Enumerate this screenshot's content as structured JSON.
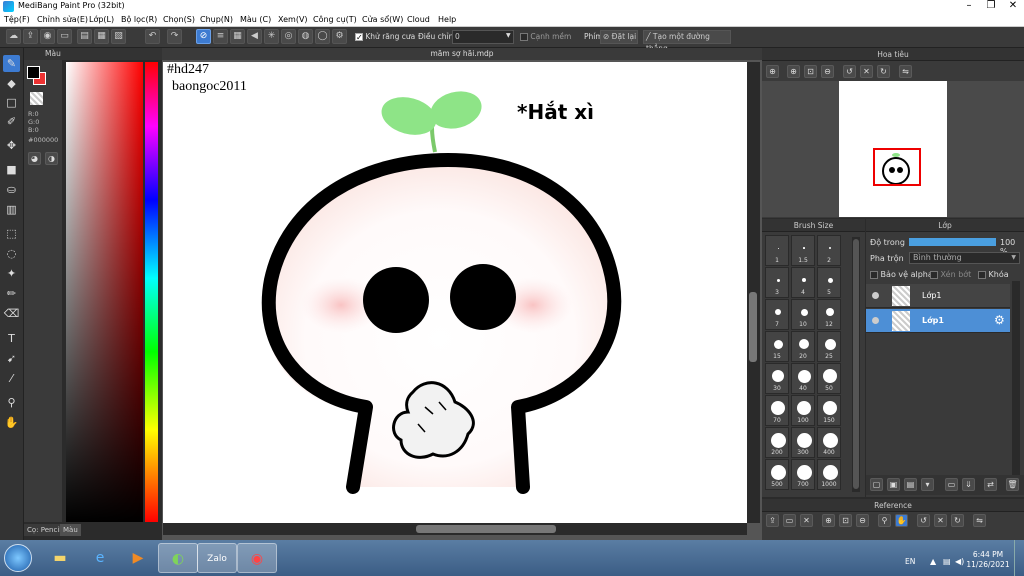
{
  "window": {
    "title": "MediBang Paint Pro (32bit)"
  },
  "menu": [
    "Tệp(F)",
    "Chỉnh sửa(E)",
    "Lớp(L)",
    "Bộ lọc(R)",
    "Chọn(S)",
    "Chụp(N)",
    "Màu (C)",
    "Xem(V)",
    "Công cụ(T)",
    "Cửa sổ(W)",
    "Cloud",
    "Help"
  ],
  "toolbar": {
    "antialias_label": "Khử răng cưa",
    "adjust_label": "Điều chỉnh",
    "adjust_value": "0",
    "smooth_label": "Cạnh mềm",
    "pen_label": "Phím",
    "reset_label": "Đặt lại",
    "straight_label": "Tạo một đường thẳng"
  },
  "color_panel": {
    "title": "Màu",
    "r": "R:0",
    "g": "G:0",
    "b": "B:0",
    "hex": "#000000",
    "foreground": "#000000",
    "background": "#ee3333",
    "tabs": [
      "Cọ: Pencil",
      "Màu"
    ]
  },
  "document": {
    "tab_title": "mãm sợ hãi.mdp",
    "canvas_text_1": "#hd247",
    "canvas_text_2": "baongoc2011",
    "canvas_text_3": "*Hắt xì"
  },
  "navigator": {
    "title": "Hoa tiêu"
  },
  "brush_size": {
    "title": "Brush Size",
    "sizes": [
      "1",
      "1.5",
      "2",
      "3",
      "4",
      "5",
      "7",
      "10",
      "12",
      "15",
      "20",
      "25",
      "30",
      "40",
      "50",
      "70",
      "100",
      "150",
      "200",
      "300",
      "400",
      "500",
      "700",
      "1000"
    ]
  },
  "layer": {
    "title": "Lớp",
    "opacity_label": "Độ trong",
    "opacity_value": "100 %",
    "opacity_fraction": 1.0,
    "blend_label": "Pha trộn",
    "blend_value": "Bình thường",
    "protect_alpha": "Bảo vệ alpha",
    "clipping": "Xén bớt",
    "lock": "Khóa",
    "layers": [
      {
        "name": "Lớp1",
        "selected": false
      },
      {
        "name": "Lớp1",
        "selected": true
      }
    ]
  },
  "reference": {
    "title": "Reference"
  },
  "taskbar": {
    "lang": "EN",
    "time": "6:44 PM",
    "date": "11/26/2021"
  }
}
